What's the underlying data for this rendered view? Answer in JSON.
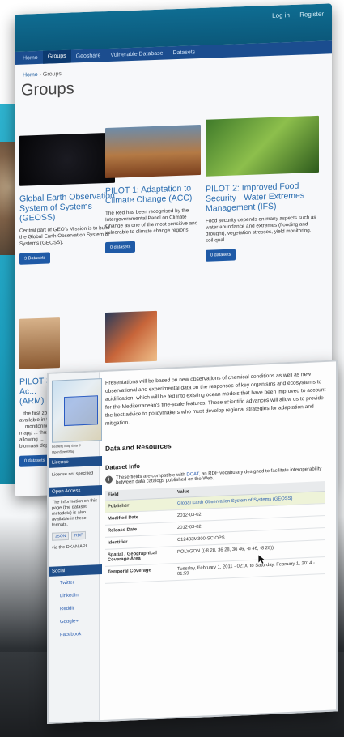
{
  "site": {
    "top_links": [
      "Log in",
      "Register"
    ],
    "nav": [
      "Home",
      "Groups",
      "Geoshare",
      "Vulnerable Database",
      "Datasets"
    ],
    "breadcrumb": [
      "Home",
      "Groups"
    ],
    "page_title": "Groups",
    "groups": [
      {
        "title": "Global Earth Observation System of Systems (GEOSS)",
        "desc": "Central part of GEO's Mission is to build the Global Earth Observation System of Systems (GEOSS).",
        "btn": "3 Datasets"
      },
      {
        "title": "PILOT 1: Adaptation to Climate Change (ACC)",
        "desc": "The Red has been recognised by the Intergovernmental Panel on Climate Change as one of the most sensitive and vulnerable to climate change regions",
        "btn": "0 datasets"
      },
      {
        "title": "PILOT 2: Improved Food Security - Water Extremes Management (IFS)",
        "desc": "Food security depends on many aspects such as water abundance and extremes (flooding and drought), vegetation stresses, yield monitoring, soil qual",
        "btn": "0 datasets"
      },
      {
        "title": "PILOT 3: Ac... (ARM)",
        "desc": "...the first zone ... available in the R ... monitoring, mapp ... thus allowing ... biomass deposit.",
        "btn": "0 datasets"
      }
    ]
  },
  "dataset": {
    "description": "Presentations will be based on new observations of chemical conditions as well as new observational and experimental data on the responses of key organisms and ecosystems to acidification, which will be fed into existing ocean models that have been improved to account for the Mediterranean's fine-scale features. These scientific advances will allow us to provide the best advice to policymakers who must develop regional strategies for adaptation and mitigation.",
    "section_resources": "Data and Resources",
    "section_info": "Dataset Info",
    "info_note_pre": "These fields are compatible with",
    "info_link": "DCAT",
    "info_note_post": ", an RDF vocabulary designed to facilitate interoperability between data catalogs published on the Web.",
    "table_headers": [
      "Field",
      "Value"
    ],
    "rows": [
      {
        "field": "Publisher",
        "value": "Global Earth Observation System of Systems (GEOSS)",
        "link": true
      },
      {
        "field": "Modified Date",
        "value": "2012-03-02"
      },
      {
        "field": "Release Date",
        "value": "2012-03-02"
      },
      {
        "field": "Identifier",
        "value": "C12483M300-SCIOPS"
      },
      {
        "field": "Spatial / Geographical Coverage Area",
        "value": "POLYGON ((-8 28, 36 28, 36 46, -8 46, -8 28))"
      },
      {
        "field": "Temporal Coverage",
        "value": "Tuesday, February 1, 2011 - 02:00 to Saturday, February 1, 2014 - 01:59"
      }
    ],
    "sidebar": {
      "map_credit": "Leaflet | Map data © OpenStreetMap",
      "license_head": "License",
      "license_text": "License not specified",
      "access_head": "Open Access",
      "access_text": "The information on this page (the dataset metadata) is also available in these formats.",
      "formats": [
        "JSON",
        "RDF"
      ],
      "via_text": "via the DKAN API",
      "social_head": "Social",
      "social_items": [
        "Twitter",
        "LinkedIn",
        "Reddit",
        "Google+",
        "Facebook"
      ]
    }
  }
}
